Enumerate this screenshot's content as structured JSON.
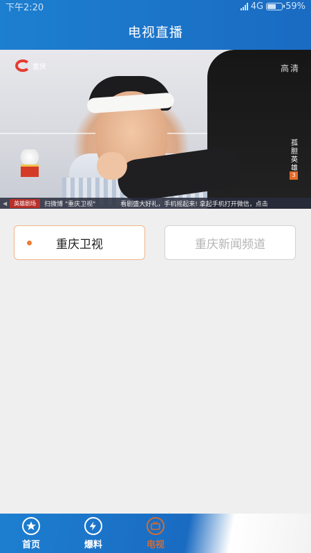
{
  "status_bar": {
    "time": "下午2:20",
    "network": "4G",
    "battery": "59%"
  },
  "header": {
    "title": "电视直播"
  },
  "player": {
    "channel_logo_text": "重庆",
    "quality_tag": "高清",
    "show_title": "孤胆英雄",
    "episode": "3",
    "ticker_tag": "英雄剧场",
    "ticker_text": "扫微博 \"重庆卫视\"　　　　看剧盛大好礼，手机摇起来! 拿起手机打开微信，点击"
  },
  "channels": [
    {
      "label": "重庆卫视",
      "active": true
    },
    {
      "label": "重庆新闻频道",
      "active": false
    }
  ],
  "bottom_nav": [
    {
      "label": "首页",
      "icon": "star-icon"
    },
    {
      "label": "爆料",
      "icon": "lightning-icon"
    },
    {
      "label": "电视",
      "icon": "tv-icon",
      "active": true
    }
  ],
  "colors": {
    "brand_blue": "#1d7fd0",
    "accent_orange": "#ec7c36"
  }
}
